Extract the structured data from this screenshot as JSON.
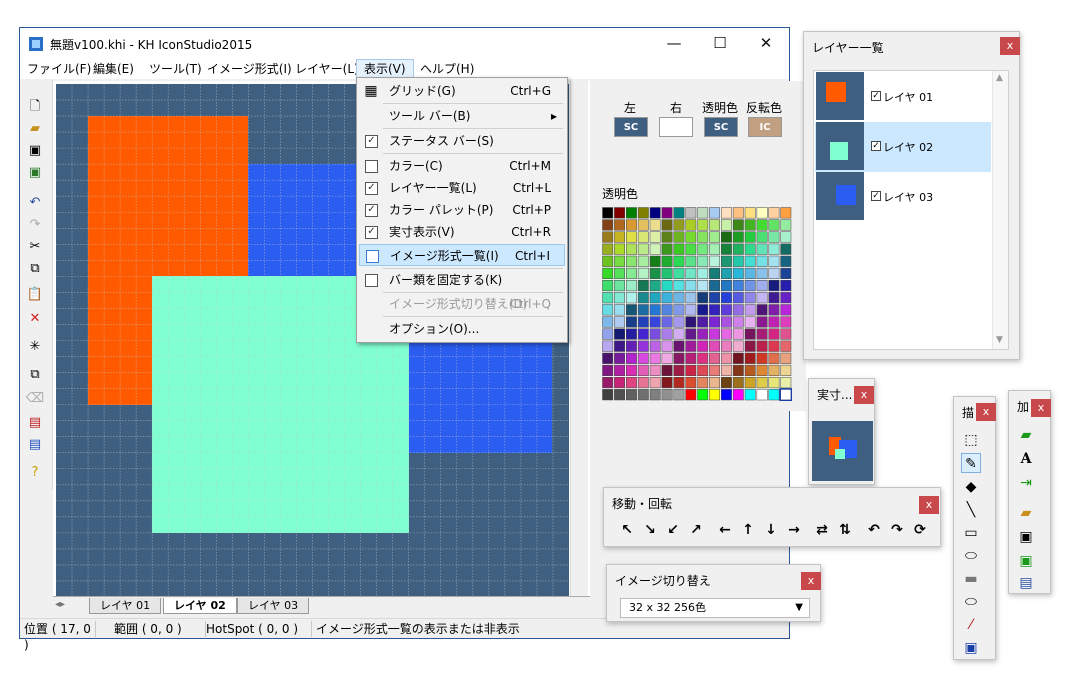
{
  "window": {
    "title": "無題v100.khi - KH IconStudio2015",
    "minimize": "—",
    "maximize": "☐",
    "close": "✕"
  },
  "menubar": [
    {
      "id": "file",
      "label": "ファイル(F)"
    },
    {
      "id": "edit",
      "label": "編集(E)"
    },
    {
      "id": "tool",
      "label": "ツール(T)"
    },
    {
      "id": "format",
      "label": "イメージ形式(I)"
    },
    {
      "id": "layer",
      "label": "レイヤー(L)"
    },
    {
      "id": "view",
      "label": "表示(V)"
    },
    {
      "id": "help",
      "label": "ヘルプ(H)"
    }
  ],
  "view_menu": [
    {
      "label": "グリッド(G)",
      "shortcut": "Ctrl+G",
      "icon": "grid-icon",
      "checked": false
    },
    {
      "label": "ツール バー(B)",
      "shortcut": "",
      "submenu": true
    },
    {
      "label": "ステータス バー(S)",
      "shortcut": "",
      "checked": true
    },
    {
      "label": "カラー(C)",
      "shortcut": "Ctrl+M",
      "checked": false
    },
    {
      "label": "レイヤー一覧(L)",
      "shortcut": "Ctrl+L",
      "checked": true
    },
    {
      "label": "カラー パレット(P)",
      "shortcut": "Ctrl+P",
      "checked": true
    },
    {
      "label": "実寸表示(V)",
      "shortcut": "Ctrl+R",
      "checked": true
    },
    {
      "label": "イメージ形式一覧(I)",
      "shortcut": "Ctrl+I",
      "checked": false,
      "highlighted": true
    },
    {
      "label": "バー類を固定する(K)",
      "shortcut": "",
      "checked": false
    },
    {
      "label": "イメージ形式切り替え(D)",
      "shortcut": "Ctrl+Q",
      "disabled": true
    },
    {
      "label": "オプション(O)...",
      "shortcut": ""
    }
  ],
  "toolbar_icons": [
    "new-icon",
    "open-icon",
    "save-icon",
    "save-as-icon",
    "undo-icon",
    "redo-icon",
    "cut-icon",
    "copy-icon",
    "paste-icon",
    "delete-icon",
    "select-all-icon",
    "duplicate-icon",
    "clear-icon",
    "layer-add-icon",
    "layer-copy-icon",
    "help-icon"
  ],
  "tabs": [
    "レイヤ 01",
    "レイヤ 02",
    "レイヤ 03"
  ],
  "status": {
    "position": "位置 ( 17, 0 )",
    "range": "範囲 ( 0, 0 )",
    "hotspot": "HotSpot ( 0, 0 )",
    "message": "イメージ形式一覧の表示または非表示"
  },
  "palette": {
    "left_label": "左",
    "right_label": "右",
    "transparent_label": "透明色",
    "inverted_label": "反転色",
    "left_swatch": "SC",
    "transparent_swatch": "SC",
    "inverted_swatch": "IC",
    "section_label": "透明色"
  },
  "colors": {
    "canvas_bg": "#3f5f80",
    "orange": "#ff5a00",
    "blue": "#2a5df0",
    "mint": "#80ffd0"
  },
  "layer_panel": {
    "title": "レイヤー一覧",
    "close": "x",
    "layers": [
      {
        "label": "レイヤ 01",
        "checked": true
      },
      {
        "label": "レイヤ 02",
        "checked": true,
        "selected": true
      },
      {
        "label": "レイヤ 03",
        "checked": true
      }
    ]
  },
  "actual_panel": {
    "title": "実寸...",
    "close": "x"
  },
  "move_panel": {
    "title": "移動・回転",
    "close": "x",
    "buttons": [
      "move-up-left-icon",
      "move-down-right-icon",
      "move-down-left-icon",
      "move-up-right-icon",
      "move-left-icon",
      "move-up-icon",
      "move-down-icon",
      "move-right-icon",
      "flip-horizontal-icon",
      "flip-vertical-icon",
      "rotate-left-icon",
      "rotate-right-icon",
      "rotate-180-icon"
    ]
  },
  "imgswitch_panel": {
    "title": "イメージ切り替え",
    "close": "x",
    "selected": "32 x 32 256色"
  },
  "draw_panel": {
    "title": "描",
    "close": "x",
    "tools": [
      "rect-select-icon",
      "pencil-icon",
      "fill-icon",
      "line-icon",
      "rect-icon",
      "ellipse-icon",
      "filled-rect-icon",
      "filled-ellipse-icon",
      "eyedropper-icon",
      "replace-color-icon"
    ]
  },
  "edit_panel": {
    "title": "加",
    "close": "x",
    "tools": [
      "fill-rect-icon",
      "text-icon",
      "export-icon",
      "import-icon",
      "save-part-icon",
      "load-part-icon",
      "gradient-icon"
    ]
  }
}
